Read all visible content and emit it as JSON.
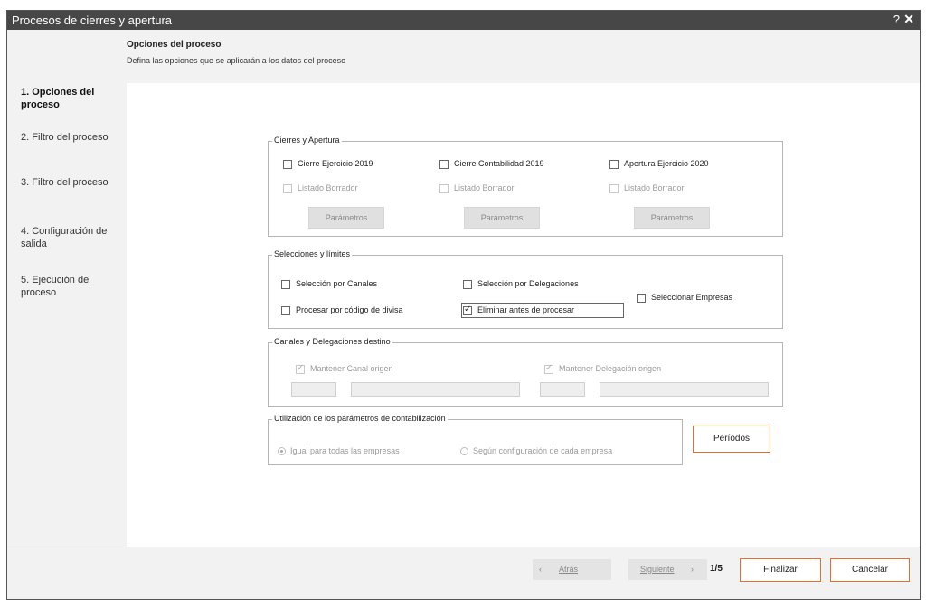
{
  "window": {
    "title": "Procesos de cierres y apertura",
    "help_glyph": "?",
    "close_glyph": "✕"
  },
  "header": {
    "title": "Opciones del proceso",
    "subtitle": "Defina las opciones que se aplicarán a los datos del proceso"
  },
  "steps": [
    {
      "label": "1. Opciones del proceso",
      "active": true
    },
    {
      "label": "2. Filtro del proceso",
      "active": false
    },
    {
      "label": "3. Filtro del proceso",
      "active": false
    },
    {
      "label": "4. Configuración de salida",
      "active": false
    },
    {
      "label": "5. Ejecución del proceso",
      "active": false
    }
  ],
  "cierres": {
    "legend": "Cierres y Apertura",
    "cierre_ejercicio": {
      "label": "Cierre Ejercicio 2019",
      "checked": false
    },
    "cierre_contabilidad": {
      "label": "Cierre Contabilidad 2019",
      "checked": false
    },
    "apertura_ejercicio": {
      "label": "Apertura Ejercicio 2020",
      "checked": false
    },
    "listado_borrador": "Listado Borrador",
    "parametros": "Parámetros"
  },
  "selecciones": {
    "legend": "Selecciones y  límites",
    "por_canales": {
      "label": "Selección por Canales",
      "checked": false
    },
    "por_delegaciones": {
      "label": "Selección por Delegaciones",
      "checked": false
    },
    "codigo_divisa": {
      "label": "Procesar por código de divisa",
      "checked": false
    },
    "eliminar": {
      "label": "Eliminar antes de procesar",
      "checked": true
    },
    "empresas": {
      "label": "Seleccionar Empresas",
      "checked": false
    }
  },
  "canales": {
    "legend": "Canales y Delegaciones destino",
    "mantener_canal": {
      "label": "Mantener Canal origen",
      "checked": true
    },
    "mantener_delegacion": {
      "label": "Mantener Delegación origen",
      "checked": true
    }
  },
  "contabilizacion": {
    "legend": "Utilización de los parámetros de contabilización",
    "igual": {
      "label": "Igual para todas las empresas",
      "selected": true
    },
    "segun": {
      "label": "Según configuración de cada empresa",
      "selected": false
    },
    "periodos": "Períodos"
  },
  "footer": {
    "atras": "Atrás",
    "siguiente": "Siguiente",
    "page": "1/5",
    "finalizar": "Finalizar",
    "cancelar": "Cancelar"
  },
  "colors": {
    "titlebar": "#474747",
    "accent_border": "#e07030",
    "panel": "#f2f2f2"
  }
}
